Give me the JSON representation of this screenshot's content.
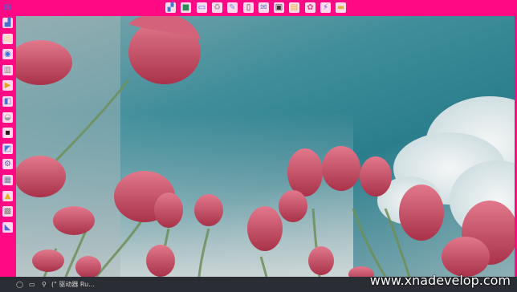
{
  "top_launcher": {
    "icons": [
      {
        "name": "explorer-window-icon",
        "glyph": "▞",
        "color": "#3a7bd5"
      },
      {
        "name": "terminal-app-icon",
        "glyph": "■",
        "color": "#2e8b57"
      },
      {
        "name": "display-window-icon",
        "glyph": "▭",
        "color": "#3a6fd8"
      },
      {
        "name": "recycle-bin-icon",
        "glyph": "♻",
        "color": "#9aa0a6"
      },
      {
        "name": "notes-app-icon",
        "glyph": "✎",
        "color": "#6c8fd8"
      },
      {
        "name": "phone-app-icon",
        "glyph": "▯",
        "color": "#444444"
      },
      {
        "name": "mail-app-icon",
        "glyph": "✉",
        "color": "#5577cc"
      },
      {
        "name": "media-player-icon",
        "glyph": "▣",
        "color": "#333333"
      },
      {
        "name": "document-app-icon",
        "glyph": "▤",
        "color": "#e8b830"
      },
      {
        "name": "paint-app-icon",
        "glyph": "✿",
        "color": "#d94a8c"
      },
      {
        "name": "network-tools-icon",
        "glyph": "⚡",
        "color": "#5a5ad8"
      },
      {
        "name": "folder-icon",
        "glyph": "▬",
        "color": "#e0b040"
      }
    ]
  },
  "side_launcher": {
    "icons": [
      {
        "name": "network-monitor-icon",
        "glyph": "▟",
        "color": "#4a72c8"
      },
      {
        "name": "notepad-icon",
        "glyph": "▤",
        "color": "#f2d98a"
      },
      {
        "name": "globe-browser-icon",
        "glyph": "◉",
        "color": "#3a6fd8"
      },
      {
        "name": "archive-app-icon",
        "glyph": "▥",
        "color": "#8a8a8a"
      },
      {
        "name": "slideshow-app-icon",
        "glyph": "▶",
        "color": "#e8a020"
      },
      {
        "name": "system-settings-icon",
        "glyph": "◧",
        "color": "#4a6fd0"
      },
      {
        "name": "disk-drive-icon",
        "glyph": "◒",
        "color": "#9a9a9a"
      },
      {
        "name": "command-prompt-icon",
        "glyph": "▪",
        "color": "#1a1a1a"
      },
      {
        "name": "remote-desktop-icon",
        "glyph": "◩",
        "color": "#4a7bd8"
      },
      {
        "name": "gears-settings-icon",
        "glyph": "⚙",
        "color": "#4a64c0"
      },
      {
        "name": "device-manager-icon",
        "glyph": "▦",
        "color": "#6a7a9a"
      },
      {
        "name": "lock-security-icon",
        "glyph": "▲",
        "color": "#e8b020"
      },
      {
        "name": "printer-icon",
        "glyph": "▩",
        "color": "#7a7a7a"
      },
      {
        "name": "user-switch-icon",
        "glyph": "◣",
        "color": "#5a6ad0"
      }
    ]
  },
  "taskbar": {
    "start_glyph": "◯",
    "task_view_glyph": "▭",
    "search_glyph": "⚲",
    "tray_text": "(\" 驱动器 Ru..."
  },
  "watermark": {
    "text": "www.xnadevelop.com"
  },
  "colors": {
    "frame_magenta": "#ff0a84",
    "taskbar": "#2a2d33",
    "sky_teal": "#2b7e8d",
    "tulip_red": "#c8445a"
  }
}
